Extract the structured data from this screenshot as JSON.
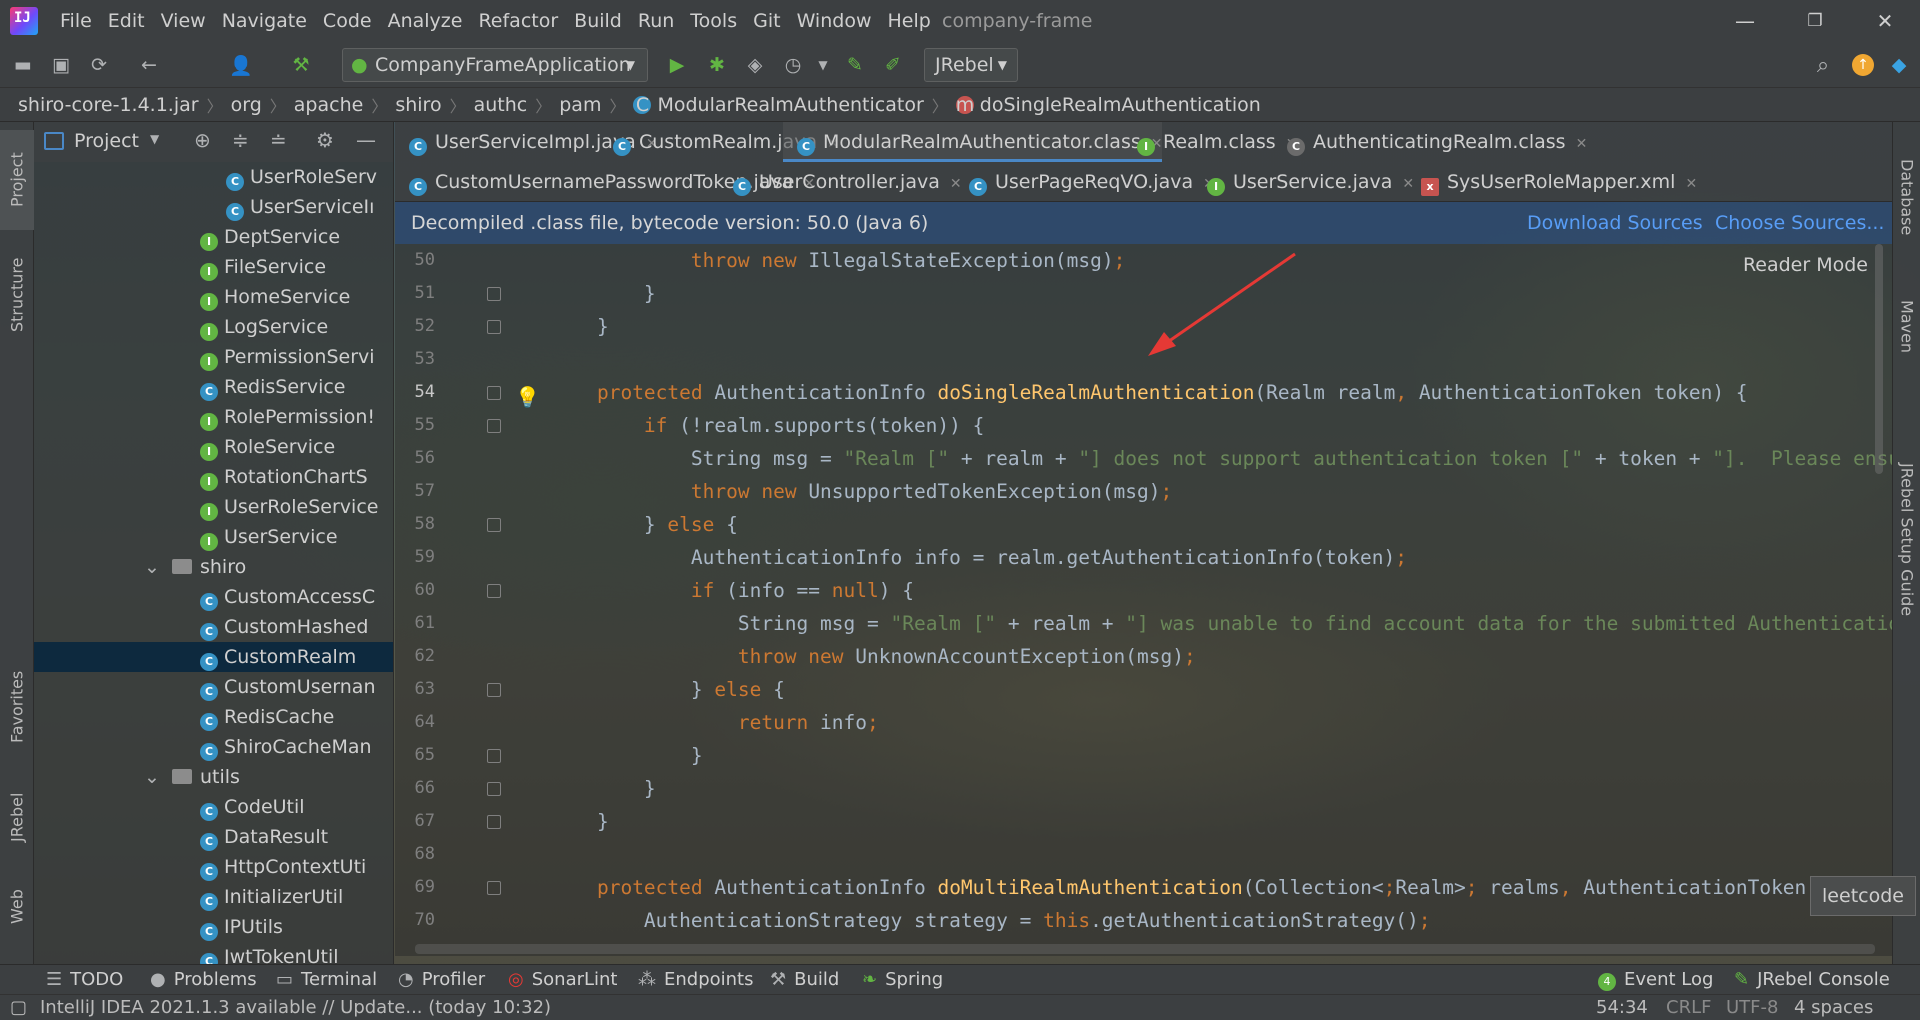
{
  "window": {
    "menu": [
      "File",
      "Edit",
      "View",
      "Navigate",
      "Code",
      "Analyze",
      "Refactor",
      "Build",
      "Run",
      "Tools",
      "Git",
      "Window",
      "Help"
    ],
    "project_name": "company-frame"
  },
  "toolbar": {
    "run_config": "CompanyFrameApplication",
    "jrebel": "JRebel"
  },
  "breadcrumbs": [
    "shiro-core-1.4.1.jar",
    "org",
    "apache",
    "shiro",
    "authc",
    "pam",
    "ModularRealmAuthenticator",
    "doSingleRealmAuthentication"
  ],
  "project_panel": {
    "title": "Project",
    "tree": [
      {
        "label": "UserRoleServ",
        "kind": "class"
      },
      {
        "label": "UserServiceIı",
        "kind": "class"
      },
      {
        "label": "DeptService",
        "kind": "interface"
      },
      {
        "label": "FileService",
        "kind": "interface"
      },
      {
        "label": "HomeService",
        "kind": "interface"
      },
      {
        "label": "LogService",
        "kind": "interface"
      },
      {
        "label": "PermissionServi",
        "kind": "interface"
      },
      {
        "label": "RedisService",
        "kind": "class"
      },
      {
        "label": "RolePermission!",
        "kind": "interface"
      },
      {
        "label": "RoleService",
        "kind": "interface"
      },
      {
        "label": "RotationChartS",
        "kind": "interface"
      },
      {
        "label": "UserRoleService",
        "kind": "interface"
      },
      {
        "label": "UserService",
        "kind": "interface"
      },
      {
        "label": "shiro",
        "kind": "folder"
      },
      {
        "label": "CustomAccessC",
        "kind": "class"
      },
      {
        "label": "CustomHashed",
        "kind": "class"
      },
      {
        "label": "CustomRealm",
        "kind": "class"
      },
      {
        "label": "CustomUsernan",
        "kind": "class"
      },
      {
        "label": "RedisCache",
        "kind": "class"
      },
      {
        "label": "ShiroCacheMan",
        "kind": "class"
      },
      {
        "label": "utils",
        "kind": "folder"
      },
      {
        "label": "CodeUtil",
        "kind": "class"
      },
      {
        "label": "DataResult",
        "kind": "class"
      },
      {
        "label": "HttpContextUti",
        "kind": "class"
      },
      {
        "label": "InitializerUtil",
        "kind": "class"
      },
      {
        "label": "IPUtils",
        "kind": "class"
      },
      {
        "label": "JwtTokenUtil",
        "kind": "class"
      }
    ]
  },
  "tabs_row1": [
    "UserServiceImpl.java",
    "CustomRealm.java",
    "ModularRealmAuthenticator.class",
    "Realm.class",
    "AuthenticatingRealm.class"
  ],
  "tabs_row2": [
    "CustomUsernamePasswordToken.java",
    "UserController.java",
    "UserPageReqVO.java",
    "UserService.java",
    "SysUserRoleMapper.xml"
  ],
  "notice": {
    "text": "Decompiled .class file, bytecode version: 50.0 (Java 6)",
    "download": "Download Sources",
    "choose": "Choose Sources..."
  },
  "reader_mode": "Reader Mode",
  "code_lines": [
    {
      "n": "50",
      "t": "            throw new IllegalStateException(msg);"
    },
    {
      "n": "51",
      "t": "        }"
    },
    {
      "n": "52",
      "t": "    }"
    },
    {
      "n": "53",
      "t": ""
    },
    {
      "n": "54",
      "t": "    protected AuthenticationInfo doSingleRealmAuthentication(Realm realm, AuthenticationToken token) {"
    },
    {
      "n": "55",
      "t": "        if (!realm.supports(token)) {"
    },
    {
      "n": "56",
      "t": "            String msg = \"Realm [\" + realm + \"] does not support authentication token [\" + token + \"].  Please ensure"
    },
    {
      "n": "57",
      "t": "            throw new UnsupportedTokenException(msg);"
    },
    {
      "n": "58",
      "t": "        } else {"
    },
    {
      "n": "59",
      "t": "            AuthenticationInfo info = realm.getAuthenticationInfo(token);"
    },
    {
      "n": "60",
      "t": "            if (info == null) {"
    },
    {
      "n": "61",
      "t": "                String msg = \"Realm [\" + realm + \"] was unable to find account data for the submitted AuthenticationT"
    },
    {
      "n": "62",
      "t": "                throw new UnknownAccountException(msg);"
    },
    {
      "n": "63",
      "t": "            } else {"
    },
    {
      "n": "64",
      "t": "                return info;"
    },
    {
      "n": "65",
      "t": "            }"
    },
    {
      "n": "66",
      "t": "        }"
    },
    {
      "n": "67",
      "t": "    }"
    },
    {
      "n": "68",
      "t": ""
    },
    {
      "n": "69",
      "t": "    protected AuthenticationInfo doMultiRealmAuthentication(Collection<Realm> realms, AuthenticationToken tok"
    },
    {
      "n": "70",
      "t": "        AuthenticationStrategy strategy = this.getAuthenticationStrategy();"
    }
  ],
  "left_stripe": [
    "Project",
    "Structure",
    "Favorites",
    "JRebel",
    "Web"
  ],
  "right_stripe": [
    "Database",
    "Maven",
    "JRebel Setup Guide"
  ],
  "tooltip": "leetcode",
  "bottom_tools": [
    "TODO",
    "Problems",
    "Terminal",
    "Profiler",
    "SonarLint",
    "Endpoints",
    "Build",
    "Spring",
    "Event Log",
    "JRebel Console"
  ],
  "status": {
    "message": "IntelliJ IDEA 2021.1.3 available // Update... (today 10:32)",
    "position": "54:34",
    "line_sep": "CRLF",
    "encoding": "UTF-8",
    "indent": "4 spaces"
  },
  "colors": {
    "keyword": "#cc7832",
    "function": "#ffc66d",
    "string": "#6a8759",
    "text": "#a9b7c6",
    "accent": "#4a88c7"
  }
}
